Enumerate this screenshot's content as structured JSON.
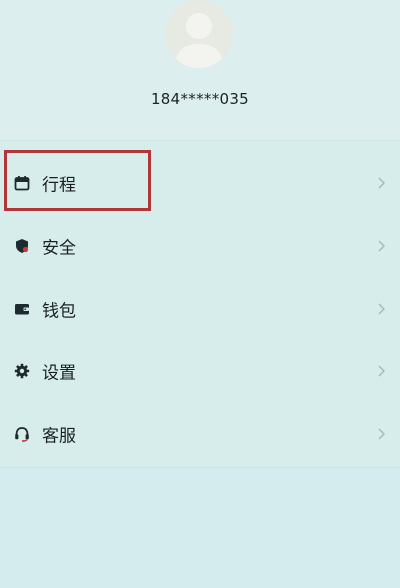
{
  "profile": {
    "phone": "184*****035"
  },
  "menu": {
    "items": [
      {
        "label": "行程",
        "icon": "calendar-icon"
      },
      {
        "label": "安全",
        "icon": "shield-icon"
      },
      {
        "label": "钱包",
        "icon": "wallet-icon"
      },
      {
        "label": "设置",
        "icon": "gear-icon"
      },
      {
        "label": "客服",
        "icon": "headset-icon"
      }
    ]
  },
  "colors": {
    "background": "#d4ecee",
    "highlight_box": "#b2353a",
    "icon": "#1f2a2e"
  }
}
